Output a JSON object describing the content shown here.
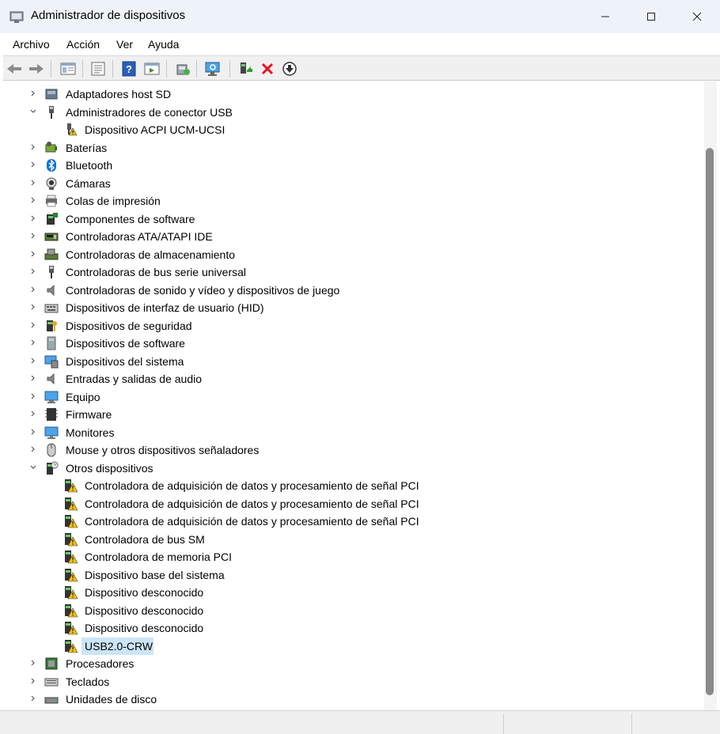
{
  "window": {
    "title": "Administrador de dispositivos",
    "icon": "device-manager-icon"
  },
  "menu": [
    "Archivo",
    "Acción",
    "Ver",
    "Ayuda"
  ],
  "toolbar": {
    "buttons": [
      "back-icon",
      "forward-icon",
      "show-hide-tree-icon",
      "properties-icon",
      "help-icon",
      "action-pane-icon",
      "update-driver-icon",
      "scan-hardware-icon",
      "enable-device-icon",
      "uninstall-device-icon",
      "disable-device-icon"
    ]
  },
  "tree": {
    "items": [
      {
        "label": "Adaptadores host SD",
        "level": 0,
        "expanded": false,
        "icon": "sd-host-icon"
      },
      {
        "label": "Administradores de conector USB",
        "level": 0,
        "expanded": true,
        "icon": "usb-connector-icon"
      },
      {
        "label": "Dispositivo ACPI UCM-UCSI",
        "level": 1,
        "icon": "usb-warning-icon"
      },
      {
        "label": "Baterías",
        "level": 0,
        "expanded": false,
        "icon": "battery-icon"
      },
      {
        "label": "Bluetooth",
        "level": 0,
        "expanded": false,
        "icon": "bluetooth-icon"
      },
      {
        "label": "Cámaras",
        "level": 0,
        "expanded": false,
        "icon": "camera-icon"
      },
      {
        "label": "Colas de impresión",
        "level": 0,
        "expanded": false,
        "icon": "printer-icon"
      },
      {
        "label": "Componentes de software",
        "level": 0,
        "expanded": false,
        "icon": "software-component-icon"
      },
      {
        "label": "Controladoras ATA/ATAPI IDE",
        "level": 0,
        "expanded": false,
        "icon": "ide-controller-icon"
      },
      {
        "label": "Controladoras de almacenamiento",
        "level": 0,
        "expanded": false,
        "icon": "storage-controller-icon"
      },
      {
        "label": "Controladoras de bus serie universal",
        "level": 0,
        "expanded": false,
        "icon": "usb-controller-icon"
      },
      {
        "label": "Controladoras de sonido y vídeo y dispositivos de juego",
        "level": 0,
        "expanded": false,
        "icon": "sound-icon"
      },
      {
        "label": "Dispositivos de interfaz de usuario (HID)",
        "level": 0,
        "expanded": false,
        "icon": "hid-icon"
      },
      {
        "label": "Dispositivos de seguridad",
        "level": 0,
        "expanded": false,
        "icon": "security-device-icon"
      },
      {
        "label": "Dispositivos de software",
        "level": 0,
        "expanded": false,
        "icon": "software-device-icon"
      },
      {
        "label": "Dispositivos del sistema",
        "level": 0,
        "expanded": false,
        "icon": "system-device-icon"
      },
      {
        "label": "Entradas y salidas de audio",
        "level": 0,
        "expanded": false,
        "icon": "audio-io-icon"
      },
      {
        "label": "Equipo",
        "level": 0,
        "expanded": false,
        "icon": "computer-icon"
      },
      {
        "label": "Firmware",
        "level": 0,
        "expanded": false,
        "icon": "firmware-icon"
      },
      {
        "label": "Monitores",
        "level": 0,
        "expanded": false,
        "icon": "monitor-icon"
      },
      {
        "label": "Mouse y otros dispositivos señaladores",
        "level": 0,
        "expanded": false,
        "icon": "mouse-icon"
      },
      {
        "label": "Otros dispositivos",
        "level": 0,
        "expanded": true,
        "icon": "other-devices-icon"
      },
      {
        "label": "Controladora de adquisición de datos y procesamiento de señal PCI",
        "level": 1,
        "icon": "warning-device-icon"
      },
      {
        "label": "Controladora de adquisición de datos y procesamiento de señal PCI",
        "level": 1,
        "icon": "warning-device-icon"
      },
      {
        "label": "Controladora de adquisición de datos y procesamiento de señal PCI",
        "level": 1,
        "icon": "warning-device-icon"
      },
      {
        "label": "Controladora de bus SM",
        "level": 1,
        "icon": "warning-device-icon"
      },
      {
        "label": "Controladora de memoria PCI",
        "level": 1,
        "icon": "warning-device-icon"
      },
      {
        "label": "Dispositivo base del sistema",
        "level": 1,
        "icon": "warning-device-icon"
      },
      {
        "label": "Dispositivo desconocido",
        "level": 1,
        "icon": "warning-device-icon"
      },
      {
        "label": "Dispositivo desconocido",
        "level": 1,
        "icon": "warning-device-icon"
      },
      {
        "label": "Dispositivo desconocido",
        "level": 1,
        "icon": "warning-device-icon"
      },
      {
        "label": "USB2.0-CRW",
        "level": 1,
        "icon": "warning-device-icon",
        "selected": true
      },
      {
        "label": "Procesadores",
        "level": 0,
        "expanded": false,
        "icon": "processor-icon"
      },
      {
        "label": "Teclados",
        "level": 0,
        "expanded": false,
        "icon": "keyboard-icon"
      },
      {
        "label": "Unidades de disco",
        "level": 0,
        "expanded": false,
        "icon": "disk-drive-icon"
      }
    ]
  },
  "colors": {
    "titlebar": "#eef3fa",
    "selection": "#cce4f7",
    "warning": "#f5c211",
    "uninstall_red": "#e81123"
  }
}
